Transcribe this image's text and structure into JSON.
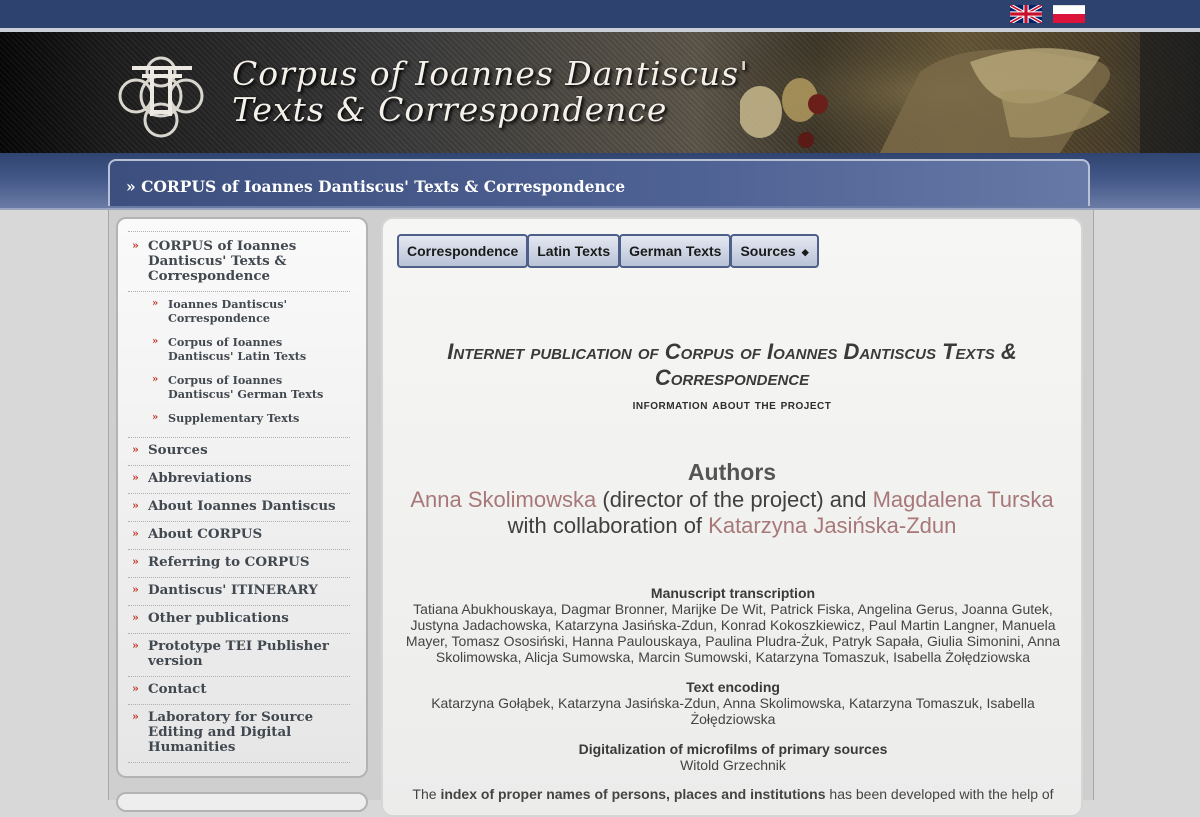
{
  "topbar": {
    "languages": [
      {
        "code": "en",
        "icon": "uk-flag-icon"
      },
      {
        "code": "pl",
        "icon": "pl-flag-icon"
      }
    ]
  },
  "header": {
    "title_line1": "Corpus of Ioannes Dantiscus'",
    "title_line2": "Texts & Correspondence"
  },
  "breadcrumb": {
    "text": "» CORPUS of Ioannes Dantiscus' Texts & Correspondence"
  },
  "sidebar": {
    "items": [
      {
        "label": "CORPUS of Ioannes Dantiscus' Texts & Correspondence"
      },
      {
        "label": "Sources"
      },
      {
        "label": "Abbreviations"
      },
      {
        "label": "About Ioannes Dantiscus"
      },
      {
        "label": "About CORPUS"
      },
      {
        "label": "Referring to CORPUS"
      },
      {
        "label": "Dantiscus' ITINERARY"
      },
      {
        "label": "Other publications"
      },
      {
        "label": "Prototype TEI Publisher version"
      },
      {
        "label": "Contact"
      },
      {
        "label": "Laboratory for Source Editing and Digital Humanities"
      }
    ],
    "subitems": [
      {
        "label": "Ioannes Dantiscus' Correspondence"
      },
      {
        "label": "Corpus of Ioannes Dantiscus' Latin Texts"
      },
      {
        "label": "Corpus of Ioannes Dantiscus' German Texts"
      },
      {
        "label": "Supplementary Texts"
      }
    ]
  },
  "tabs": [
    {
      "label": "Correspondence"
    },
    {
      "label": "Latin Texts"
    },
    {
      "label": "German Texts"
    },
    {
      "label": "Sources",
      "has_dropdown": true
    }
  ],
  "main": {
    "title": "Internet publication of Corpus of Ioannes Dantiscus Texts & Correspondence",
    "subtitle": "information about the project",
    "authors_heading": "Authors",
    "author1": "Anna Skolimowska",
    "author1_role": " (director of the project) and ",
    "author2": "Magdalena Turska",
    "collab_prefix": "with collaboration of ",
    "author3": "Katarzyna Jasińska-Zdun",
    "transcription_heading": "Manuscript transcription",
    "transcription_names": "Tatiana Abukhouskaya, Dagmar Bronner, Marijke De Wit, Patrick Fiska, Angelina Gerus, Joanna Gutek, Justyna Jadachowska, Katarzyna Jasińska-Zdun, Konrad Kokoszkiewicz, Paul Martin Langner, Manuela Mayer, Tomasz Ososiński, Hanna Paulouskaya, Paulina Pludra-Żuk, Patryk Sapała, Giulia Simonini, Anna Skolimowska, Alicja Sumowska, Marcin Sumowski, Katarzyna Tomaszuk, Isabella Żołędziowska",
    "encoding_heading": "Text encoding",
    "encoding_names": "Katarzyna Gołąbek, Katarzyna Jasińska-Zdun, Anna Skolimowska, Katarzyna Tomaszuk, Isabella Żołędziowska",
    "digitalization_heading": "Digitalization of microfilms of primary sources",
    "digitalization_names": "Witold Grzechnik",
    "index_prefix": "The ",
    "index_bold": "index of proper names of persons, places and institutions",
    "index_suffix": " has been developed with the help of"
  },
  "colors": {
    "topbar": "#2e4270",
    "author_link": "#a87878",
    "bullet": "#c0392b",
    "tab_border": "#4e5f8a"
  }
}
